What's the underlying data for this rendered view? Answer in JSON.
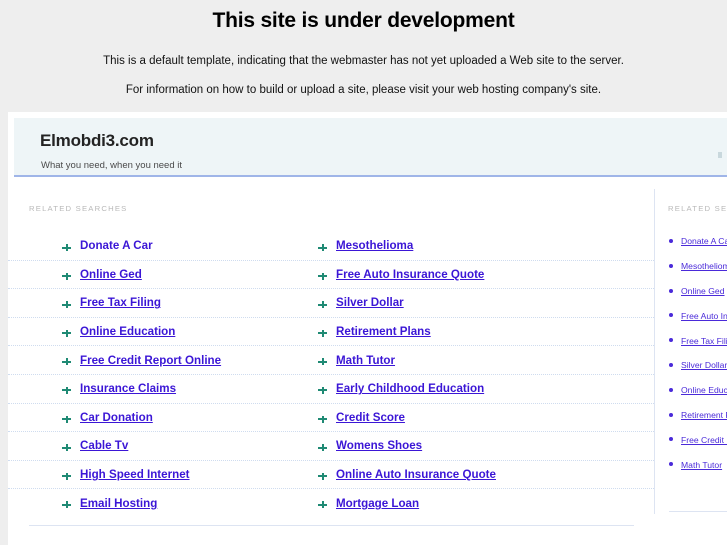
{
  "notice": {
    "title": "This site is under development",
    "line1": "This is a default template, indicating that the webmaster has not yet uploaded a Web site to the server.",
    "line2": "For information on how to build or upload a site, please visit your web hosting company's site."
  },
  "park": {
    "domain": "Elmobdi3.com",
    "tagline": "What you need, when you need it",
    "section_label": "RELATED SEARCHES",
    "bullet_icon": "arrow-bullet-icon",
    "link_color": "#3b16d6",
    "header_bg": "#eef5f7",
    "header_rule_color": "#9fb5e8",
    "bullet_color": "#1f8a74",
    "rows": [
      {
        "left": "Donate A Car",
        "right": "Mesothelioma"
      },
      {
        "left": "Online Ged",
        "right": "Free Auto Insurance Quote"
      },
      {
        "left": "Free Tax Filing",
        "right": "Silver Dollar"
      },
      {
        "left": "Online Education",
        "right": "Retirement Plans"
      },
      {
        "left": "Free Credit Report Online",
        "right": "Math Tutor"
      },
      {
        "left": "Insurance Claims",
        "right": "Early Childhood Education"
      },
      {
        "left": "Car Donation",
        "right": "Credit Score"
      },
      {
        "left": "Cable Tv",
        "right": "Womens Shoes"
      },
      {
        "left": "High Speed Internet",
        "right": "Online Auto Insurance Quote"
      },
      {
        "left": "Email Hosting",
        "right": "Mortgage Loan"
      }
    ]
  },
  "rail": {
    "section_label": "RELATED SEARCHES",
    "bullet_icon": "dot-bullet-icon",
    "items": [
      "Donate A Car",
      "Mesothelioma",
      "Online Ged",
      "Free Auto Insurance Quote",
      "Free Tax Filing",
      "Silver Dollar",
      "Online Education",
      "Retirement Plans",
      "Free Credit Report Online",
      "Math Tutor"
    ]
  }
}
